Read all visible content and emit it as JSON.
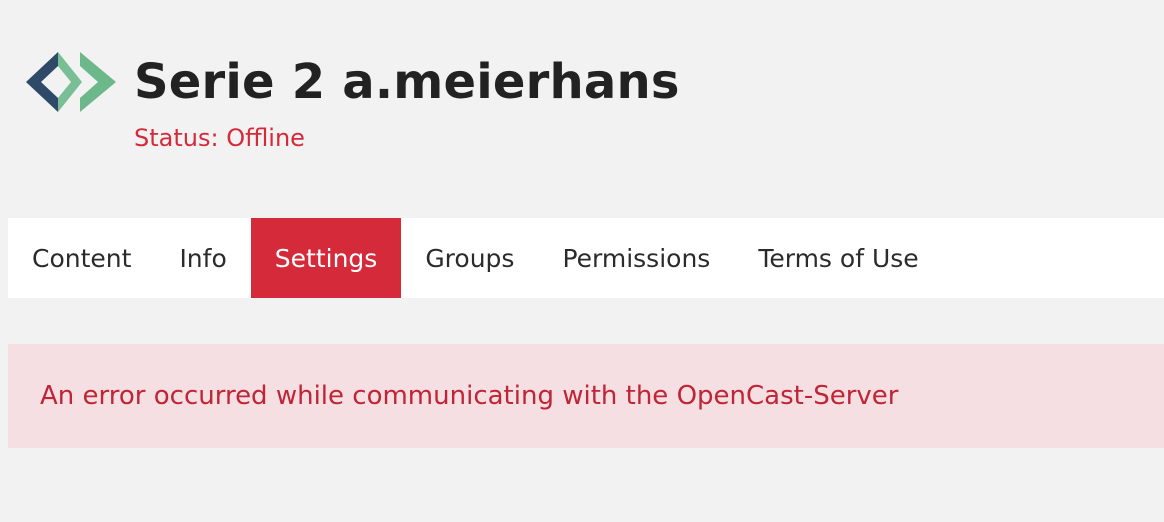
{
  "header": {
    "logo_icon": "opencast-logo-icon",
    "title": "Serie 2 a.meierhans",
    "status": "Status: Offline"
  },
  "tabs": [
    {
      "label": "Content",
      "active": false
    },
    {
      "label": "Info",
      "active": false
    },
    {
      "label": "Settings",
      "active": true
    },
    {
      "label": "Groups",
      "active": false
    },
    {
      "label": "Permissions",
      "active": false
    },
    {
      "label": "Terms of Use",
      "active": false
    }
  ],
  "alert": {
    "message": "An error occurred while communicating with the OpenCast-Server"
  },
  "colors": {
    "accent": "#d42a3a",
    "logo_dark": "#2f4a68",
    "logo_green": "#6cb88a",
    "alert_bg": "#f5dfe2",
    "page_bg": "#f2f2f2"
  }
}
